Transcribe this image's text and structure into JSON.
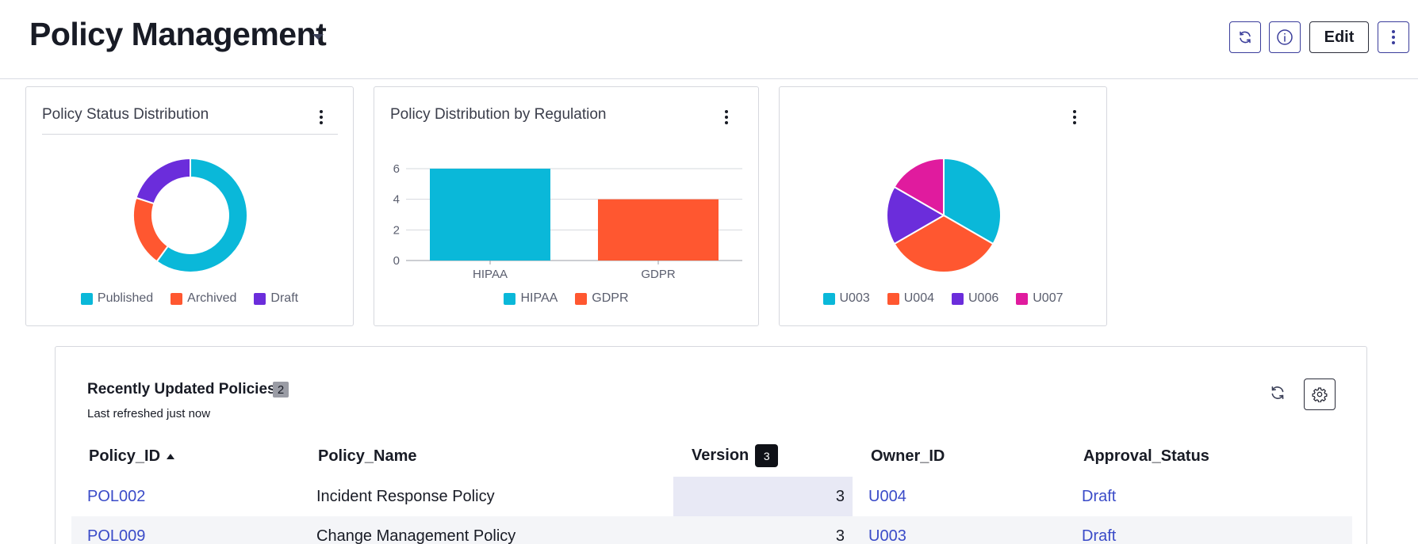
{
  "header": {
    "title": "Policy Management",
    "edit_label": "Edit",
    "refresh_icon": "refresh-icon",
    "info_icon": "info-icon",
    "more_icon": "kebab-icon"
  },
  "cards": {
    "status": {
      "title": "Policy Status Distribution",
      "legend": [
        "Published",
        "Archived",
        "Draft"
      ]
    },
    "regulation": {
      "title": "Policy Distribution by Regulation",
      "legend": [
        "HIPAA",
        "GDPR"
      ]
    },
    "owner": {
      "legend": [
        "U003",
        "U004",
        "U006",
        "U007"
      ]
    }
  },
  "chart_data": [
    {
      "type": "pie",
      "title": "Policy Status Distribution",
      "donut": true,
      "categories": [
        "Published",
        "Archived",
        "Draft"
      ],
      "values": [
        6,
        2,
        2
      ],
      "colors": [
        "#0ab8d9",
        "#ff5730",
        "#6b2ddb"
      ],
      "legend_position": "bottom"
    },
    {
      "type": "bar",
      "title": "Policy Distribution by Regulation",
      "categories": [
        "HIPAA",
        "GDPR"
      ],
      "values": [
        6,
        4
      ],
      "colors": [
        "#0ab8d9",
        "#ff5730"
      ],
      "y_ticks": [
        0,
        2,
        4,
        6
      ],
      "ylim": [
        0,
        6
      ],
      "grid": true,
      "legend_position": "bottom"
    },
    {
      "type": "pie",
      "categories": [
        "U003",
        "U004",
        "U006",
        "U007"
      ],
      "values": [
        3,
        3,
        1.5,
        1.5
      ],
      "colors": [
        "#0ab8d9",
        "#ff5730",
        "#6b2ddb",
        "#e01b9e"
      ],
      "legend_position": "bottom"
    }
  ],
  "table": {
    "title": "Recently Updated Policies",
    "count": "2",
    "subtitle": "Last refreshed just now",
    "columns": {
      "policy_id": "Policy_ID",
      "policy_name": "Policy_Name",
      "version": "Version",
      "version_badge": "3",
      "owner_id": "Owner_ID",
      "approval_status": "Approval_Status"
    },
    "rows": [
      {
        "policy_id": "POL002",
        "policy_name": "Incident Response Policy",
        "version": "3",
        "owner_id": "U004",
        "approval_status": "Draft"
      },
      {
        "policy_id": "POL009",
        "policy_name": "Change Management Policy",
        "version": "3",
        "owner_id": "U003",
        "approval_status": "Draft"
      }
    ]
  }
}
